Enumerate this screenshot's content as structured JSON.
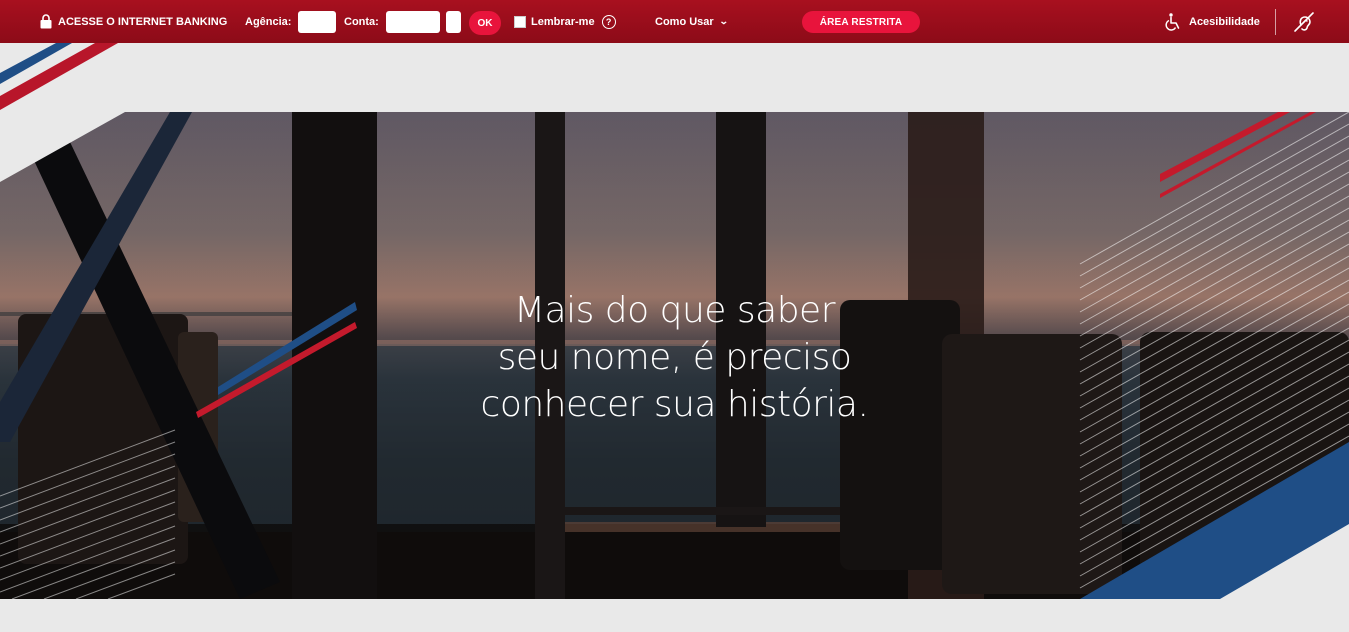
{
  "topbar": {
    "internet_banking_label": "ACESSE O INTERNET BANKING",
    "agency_label": "Agência:",
    "agency_value": "",
    "account_label": "Conta:",
    "account_value": "",
    "digit_value": "",
    "ok_label": "OK",
    "remember_label": "Lembrar-me",
    "help_glyph": "?",
    "how_to_use_label": "Como Usar",
    "restricted_area_label": "ÁREA RESTRITA",
    "accessibility_label": "Acesibilidade"
  },
  "hero": {
    "headline_lines": [
      "Mais do que saber",
      "seu nome, é preciso",
      "conhecer sua história."
    ]
  },
  "colors": {
    "brand_red": "#9c0e1c",
    "accent_red": "#e8143c",
    "stripe_blue": "#1f4e86",
    "page_bg": "#e9e9e9"
  },
  "icons": [
    "lock-icon",
    "help-icon",
    "chevron-down-icon",
    "accessibility-icon",
    "hearing-icon"
  ]
}
